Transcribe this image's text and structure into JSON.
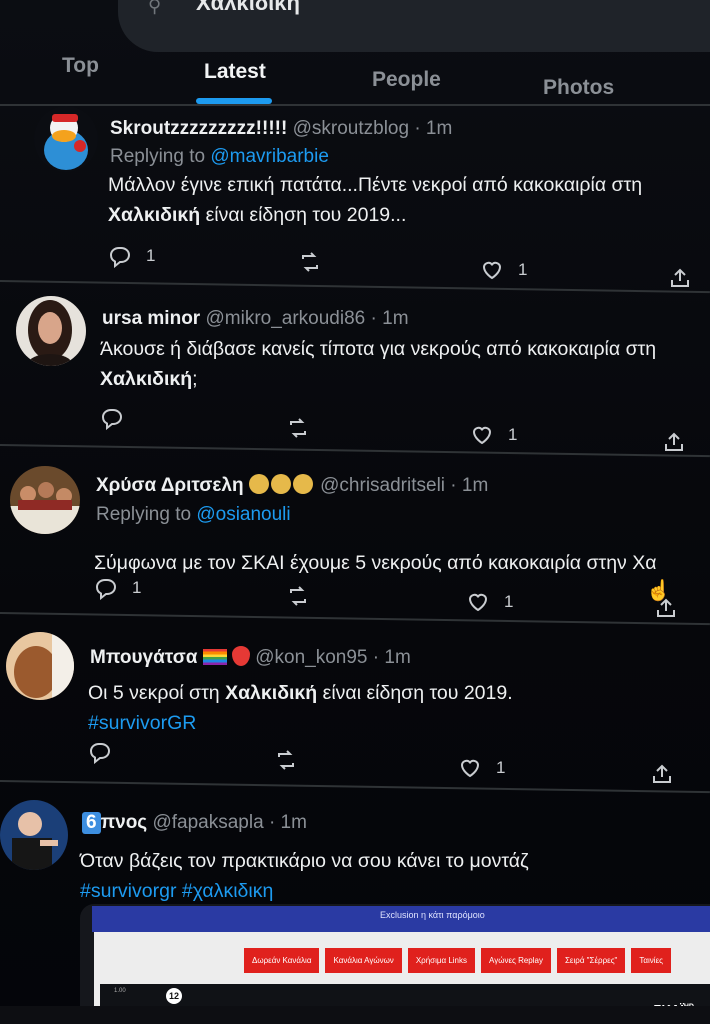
{
  "search": {
    "query": "Χαλκιδική"
  },
  "tabs": [
    {
      "label": "Top"
    },
    {
      "label": "Latest"
    },
    {
      "label": "People"
    },
    {
      "label": "Photos"
    }
  ],
  "tweets": [
    {
      "name": "Skroutzzzzzzzzz!!!!!",
      "handle": "@skroutzblog",
      "time": "· 1m",
      "reply_prefix": "Replying to",
      "reply_to": "@mavribarbie",
      "body_line1": "Μάλλον έγινε επική πατάτα...Πέντε νεκροί από κακοκαιρία στη",
      "body_line2_bold": "Χαλκιδική",
      "body_line2_rest": " είναι είδηση του 2019...",
      "replies": "1",
      "likes": "1"
    },
    {
      "name": "ursa minor",
      "handle": "@mikro_arkoudi86",
      "time": "· 1m",
      "body_line1": "Άκουσε ή διάβασε κανείς τίποτα για νεκρούς από κακοκαιρία στη",
      "body_line2_bold": "Χαλκιδική",
      "body_line2_rest": ";",
      "likes": "1"
    },
    {
      "name": "Χρύσα Δριτσελη",
      "handle": "@chrisadritseli",
      "time": "· 1m",
      "reply_prefix": "Replying to",
      "reply_to": "@osianouli",
      "body_line1": "Σύμφωνα με τον ΣΚΑΙ έχουμε 5 νεκρούς από κακοκαιρία στην Χα",
      "replies": "1",
      "likes": "1"
    },
    {
      "name": "Μπουγάτσα",
      "handle": "@kon_kon95",
      "time": "· 1m",
      "body_pre": "Οι 5 νεκροί στη ",
      "body_bold": "Χαλκιδική",
      "body_post": " είναι είδηση του 2019.",
      "hashtag": "#survivorGR",
      "likes": "1"
    },
    {
      "name_badge": "6",
      "name": "πνος",
      "handle": "@fapaksapla",
      "time": "· 1m",
      "body_line1": "Όταν βάζεις τον πρακτικάριο να σου κάνει το μοντάζ",
      "hashtags": "#survivorgr #χαλκιδικη"
    }
  ],
  "media": {
    "title": "Exclusion η κάτι παρόμοιο",
    "buttons": [
      "Δωρεάν Κανάλια",
      "Κανάλια Αγώνων",
      "Χρήσιμα Links",
      "Αγώνες Replay",
      "Σειρά \"Σέρρες\"",
      "Ταινίες"
    ],
    "small_text": "1.00",
    "age_badge": "12",
    "logo": "ΣΚΑΪ",
    "logo_suffix": "HD"
  },
  "colors": {
    "accent": "#1d9bf0",
    "background": "#05060a",
    "muted": "#8b9096"
  }
}
